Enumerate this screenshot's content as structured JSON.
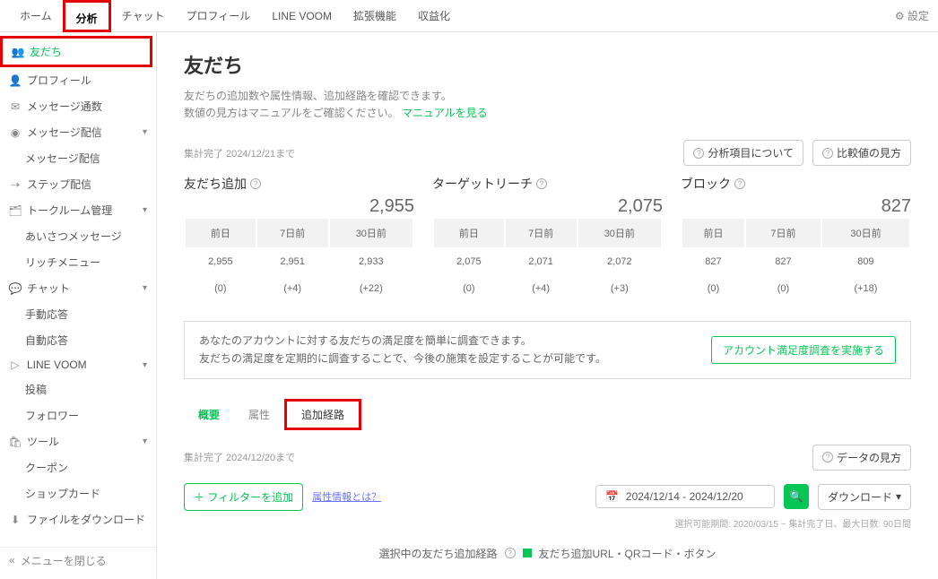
{
  "topnav": {
    "items": [
      "ホーム",
      "分析",
      "チャット",
      "プロフィール",
      "LINE VOOM",
      "拡張機能",
      "収益化"
    ],
    "settings": "設定"
  },
  "sidebar": {
    "items": [
      {
        "label": "友だち",
        "icon": "users"
      },
      {
        "label": "プロフィール",
        "icon": "user"
      },
      {
        "label": "メッセージ通数",
        "icon": "mail"
      },
      {
        "label": "メッセージ配信",
        "icon": "broadcast",
        "expand": true
      },
      {
        "label": "メッセージ配信",
        "sub": true
      },
      {
        "label": "ステップ配信",
        "icon": "flow"
      },
      {
        "label": "トークルーム管理",
        "icon": "room",
        "expand": true
      },
      {
        "label": "あいさつメッセージ",
        "sub": true
      },
      {
        "label": "リッチメニュー",
        "sub": true
      },
      {
        "label": "チャット",
        "icon": "chat",
        "expand": true
      },
      {
        "label": "手動応答",
        "sub": true
      },
      {
        "label": "自動応答",
        "sub": true
      },
      {
        "label": "LINE VOOM",
        "icon": "play",
        "expand": true
      },
      {
        "label": "投稿",
        "sub": true
      },
      {
        "label": "フォロワー",
        "sub": true
      },
      {
        "label": "ツール",
        "icon": "bag",
        "expand": true
      },
      {
        "label": "クーポン",
        "sub": true
      },
      {
        "label": "ショップカード",
        "sub": true
      },
      {
        "label": "ファイルをダウンロード",
        "icon": "download"
      }
    ],
    "footer": "メニューを閉じる"
  },
  "main": {
    "title": "友だち",
    "desc1": "友だちの追加数や属性情報、追加経路を確認できます。",
    "desc2a": "数値の見方はマニュアルをご確認ください。",
    "desc2link": "マニュアルを見る",
    "meta1": "集計完了 2024/12/21まで",
    "btn_about": "分析項目について",
    "btn_compare": "比較値の見方",
    "cards": [
      {
        "title": "友だち追加",
        "big": "2,955",
        "cols": [
          "前日",
          "7日前",
          "30日前"
        ],
        "vals": [
          "2,955",
          "2,951",
          "2,933"
        ],
        "deltas": [
          "(0)",
          "(+4)",
          "(+22)"
        ]
      },
      {
        "title": "ターゲットリーチ",
        "big": "2,075",
        "cols": [
          "前日",
          "7日前",
          "30日前"
        ],
        "vals": [
          "2,075",
          "2,071",
          "2,072"
        ],
        "deltas": [
          "(0)",
          "(+4)",
          "(+3)"
        ]
      },
      {
        "title": "ブロック",
        "big": "827",
        "cols": [
          "前日",
          "7日前",
          "30日前"
        ],
        "vals": [
          "827",
          "827",
          "809"
        ],
        "deltas": [
          "(0)",
          "(0)",
          "(+18)"
        ]
      }
    ],
    "banner": {
      "l1": "あなたのアカウントに対する友だちの満足度を簡単に調査できます。",
      "l2": "友だちの満足度を定期的に調査することで、今後の施策を設定することが可能です。",
      "cta": "アカウント満足度調査を実施する"
    },
    "tabs": [
      "概要",
      "属性",
      "追加経路"
    ],
    "meta2": "集計完了 2024/12/20まで",
    "btn_dataview": "データの見方",
    "filter": {
      "add": "フィルターを追加",
      "attr_link": "属性情報とは？",
      "date": "2024/12/14 - 2024/12/20",
      "download": "ダウンロード"
    },
    "note": "選択可能期間: 2020/03/15 ~ 集計完了日、最大日数: 90日間",
    "legend": {
      "title": "選択中の友だち追加経路",
      "label": "友だち追加URL・QRコード・ボタン"
    }
  }
}
